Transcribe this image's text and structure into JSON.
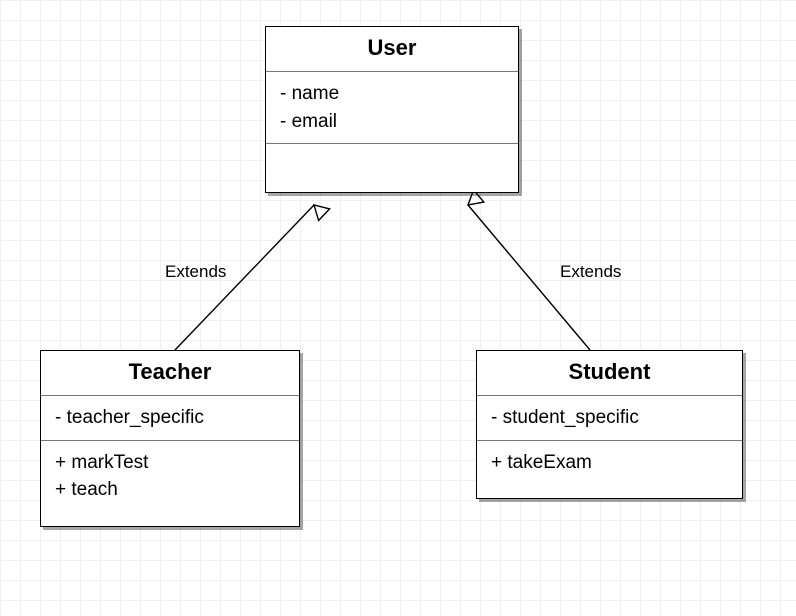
{
  "diagram_type": "uml-class-diagram",
  "classes": {
    "user": {
      "name": "User",
      "attributes": [
        "- name",
        "- email"
      ],
      "operations": []
    },
    "teacher": {
      "name": "Teacher",
      "attributes": [
        "- teacher_specific"
      ],
      "operations": [
        "+ markTest",
        "+ teach"
      ]
    },
    "student": {
      "name": "Student",
      "attributes": [
        "- student_specific"
      ],
      "operations": [
        "+ takeExam"
      ]
    }
  },
  "relationships": [
    {
      "from": "teacher",
      "to": "user",
      "type": "generalization",
      "label": "Extends"
    },
    {
      "from": "student",
      "to": "user",
      "type": "generalization",
      "label": "Extends"
    }
  ]
}
